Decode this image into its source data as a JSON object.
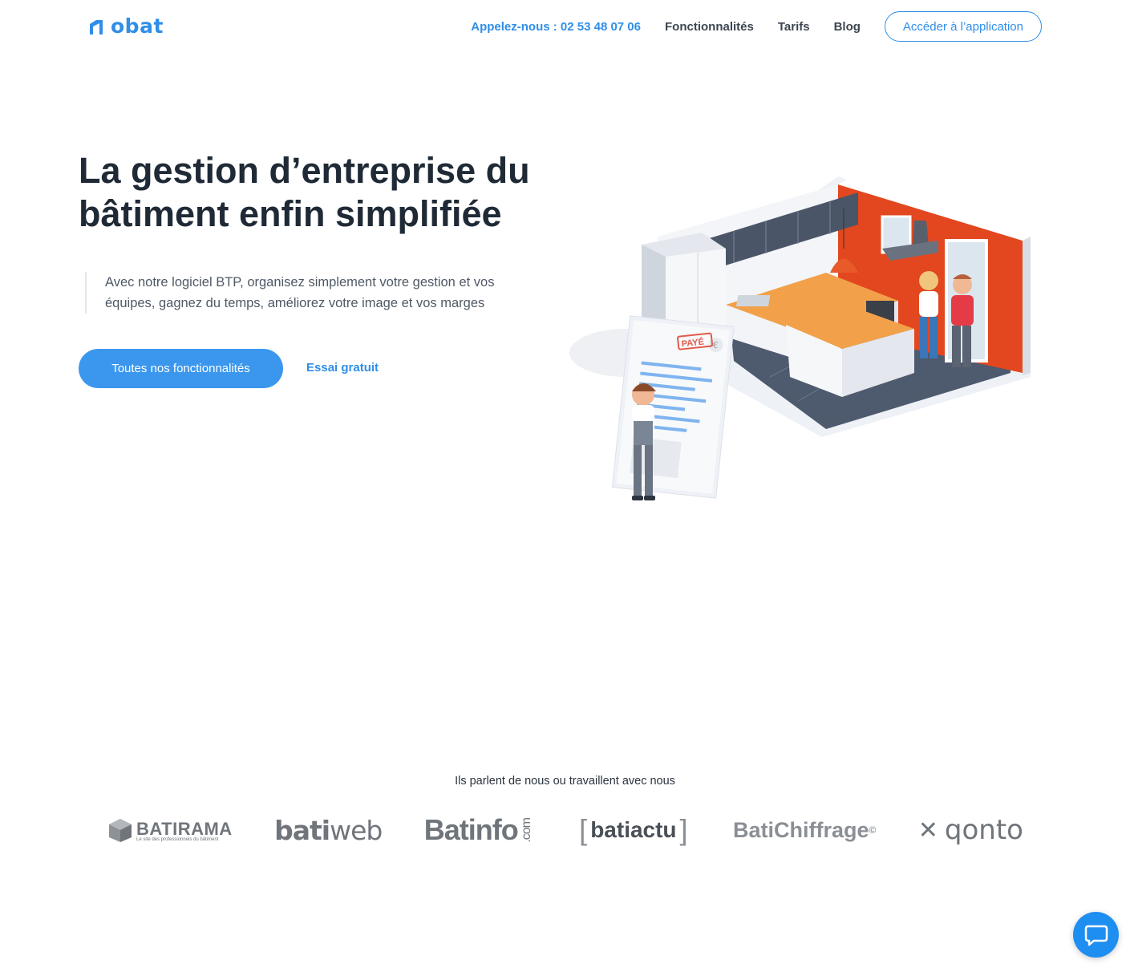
{
  "header": {
    "logo_text": "obat",
    "phone": "Appelez-nous : 02 53 48 07 06",
    "nav": [
      "Fonctionnalités",
      "Tarifs",
      "Blog"
    ],
    "cta": "Accéder à l’application"
  },
  "hero": {
    "title_line1": "La gestion d’entreprise du",
    "title_line2": "bâtiment enfin simplifiée",
    "quote_line1": "Avec notre logiciel BTP, organisez simplement votre gestion et vos",
    "quote_line2": "équipes, gagnez du temps, améliorez votre image et vos marges",
    "primary_button": "Toutes nos fonctionnalités",
    "secondary_link": "Essai gratuit",
    "illustration_stamp": "PAYÉ",
    "illustration_currency": "€"
  },
  "partners": {
    "title": "Ils parlent de nous ou travaillent avec nous",
    "batirama": "BATIRAMA",
    "batirama_sub": "Le site des professionnels du bâtiment",
    "batiweb_bold": "bati",
    "batiweb_rest": "web",
    "batinfo": "Batinfo",
    "batinfo_suffix": ".com",
    "batiactu": "batiactu",
    "batichiffrage": "BatiChiffrage",
    "batichiffrage_mark": "©",
    "qonto": "qonto"
  },
  "colors": {
    "brand": "#2f8ee8",
    "primary_button": "#3b97ee",
    "chat": "#1f8ef1",
    "kitchen_wall": "#e2471f"
  },
  "icons": {
    "logo": "obat-logo-icon",
    "chat": "chat-bubble-icon"
  }
}
